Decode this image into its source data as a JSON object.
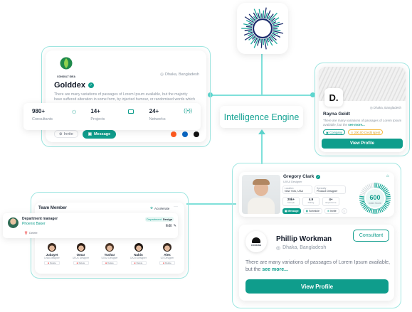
{
  "engine": {
    "label": "Intelligence Engine"
  },
  "golddex": {
    "logo_text": "CONSULT IDEA",
    "location": "Dhaka, Bangladesh",
    "name": "Golddex",
    "description": "There are many variations of passages of Lorem Ipsum available, but the majority have suffered alteration in some form, by injected humour, or randomised words which don't look",
    "stats": [
      {
        "value": "980+",
        "label": "Consultants",
        "icon": "users-icon"
      },
      {
        "value": "14+",
        "label": "Projects",
        "icon": "folder-icon"
      },
      {
        "value": "24+",
        "label": "Networks",
        "icon": "network-icon"
      }
    ],
    "invite_label": "Invite",
    "message_label": "Message",
    "social": [
      "reddit-icon",
      "linkedin-icon",
      "x-icon"
    ]
  },
  "rayna": {
    "logo_letter": "D.",
    "location": "Dhaka, Bangladesh",
    "name": "Rayna Geidt",
    "description": "There are many variations of passages of Lorem Ipsum available, but the",
    "see_more": "see more...",
    "tag_company": "Company",
    "tag_credit": "200.00 Credit spent",
    "view_profile": "View Profile"
  },
  "gregory": {
    "name": "Gregory Clark",
    "role": "UX/UI Designer",
    "location_label": "Location",
    "location_value": "New York, USA",
    "specialty_label": "Specialty",
    "specialty_value": "Product Designer",
    "stats": [
      {
        "value": "20k+",
        "label": "Sample"
      },
      {
        "value": "4.9",
        "label": "Rating"
      },
      {
        "value": "4+",
        "label": "Experience"
      }
    ],
    "score": "600",
    "score_label": "Index Score",
    "buttons": {
      "message": "Message",
      "schedule": "Schedule",
      "invite": "Invite"
    }
  },
  "phillip": {
    "logo_text": "COOKING",
    "name": "Phillip Workman",
    "badge": "Consultant",
    "location": "Dhaka, Bangladesh",
    "description": "There are many variations of passages of Lorem Ipsum available, but the",
    "see_more": "see more...",
    "view_profile": "View Profile"
  },
  "team": {
    "title": "Team Member",
    "action": "Accelerate",
    "selected": {
      "role": "Department manager",
      "name": "Phoenix Baker",
      "tag_department": "Department",
      "tag_value": "Design",
      "edit_label": "Edit",
      "delete_label": "Delete"
    },
    "members": [
      {
        "name": "Jubayet",
        "role": "Lead Designer",
        "action": "Delete"
      },
      {
        "name": "Omar",
        "role": "UI/UX Designer",
        "action": "Delete"
      },
      {
        "name": "Tushar",
        "role": "UX/UI Designer",
        "action": "Delete"
      },
      {
        "name": "Nabin",
        "role": "UX/UI Designer",
        "action": "Delete"
      },
      {
        "name": "Alex",
        "role": "UX Designer",
        "action": "Delete"
      }
    ]
  },
  "colors": {
    "teal": "#0f9d8c",
    "connector": "#7fe0da",
    "frame": "#9fe6e1"
  }
}
